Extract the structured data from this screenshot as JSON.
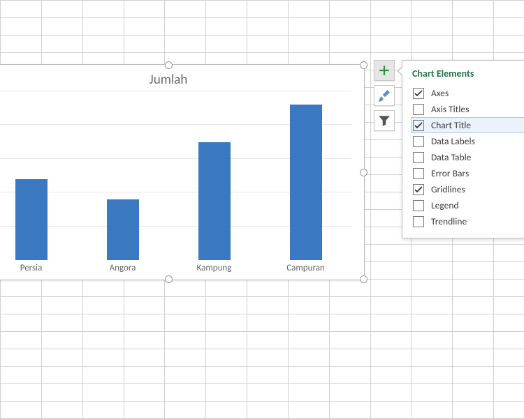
{
  "chart_data": {
    "type": "bar",
    "title": "Jumlah",
    "categories": [
      "Persia",
      "Angora",
      "Kampung",
      "Campuran"
    ],
    "values": [
      4.8,
      3.6,
      7.0,
      9.2
    ],
    "xlabel": "",
    "ylabel": "",
    "ylim": [
      0,
      10
    ],
    "grid": true,
    "legend": false
  },
  "side_buttons": {
    "add": "chart-elements",
    "style": "chart-styles",
    "filter": "chart-filters"
  },
  "flyout": {
    "title": "Chart Elements",
    "items": [
      {
        "label": "Axes",
        "checked": true,
        "hover": false
      },
      {
        "label": "Axis Titles",
        "checked": false,
        "hover": false
      },
      {
        "label": "Chart Title",
        "checked": true,
        "hover": true
      },
      {
        "label": "Data Labels",
        "checked": false,
        "hover": false
      },
      {
        "label": "Data Table",
        "checked": false,
        "hover": false
      },
      {
        "label": "Error Bars",
        "checked": false,
        "hover": false
      },
      {
        "label": "Gridlines",
        "checked": true,
        "hover": false
      },
      {
        "label": "Legend",
        "checked": false,
        "hover": false
      },
      {
        "label": "Trendline",
        "checked": false,
        "hover": false
      }
    ]
  }
}
